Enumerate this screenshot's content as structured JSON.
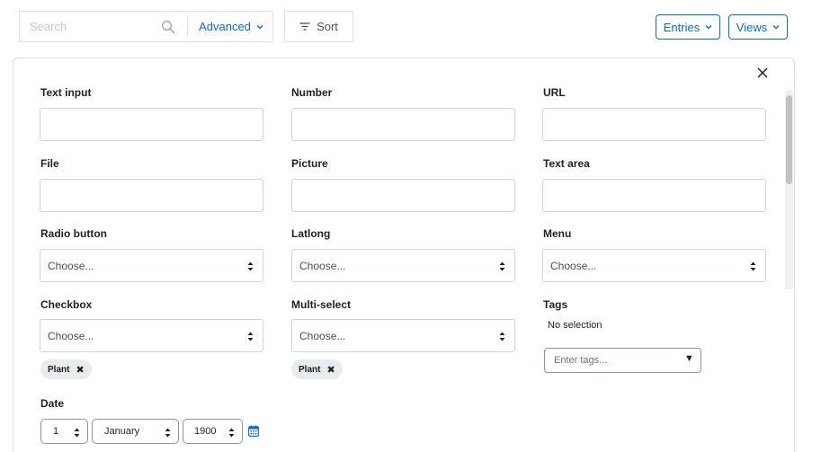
{
  "toolbar": {
    "search_placeholder": "Search",
    "advanced_label": "Advanced",
    "sort_label": "Sort",
    "entries_label": "Entries",
    "views_label": "Views"
  },
  "form": {
    "text_input_label": "Text input",
    "number_label": "Number",
    "url_label": "URL",
    "file_label": "File",
    "picture_label": "Picture",
    "textarea_label": "Text area",
    "radio_label": "Radio button",
    "radio_value": "Choose...",
    "latlong_label": "Latlong",
    "latlong_value": "Choose...",
    "menu_label": "Menu",
    "menu_value": "Choose...",
    "checkbox_label": "Checkbox",
    "checkbox_value": "Choose...",
    "checkbox_chip": "Plant",
    "multiselect_label": "Multi-select",
    "multiselect_value": "Choose...",
    "multiselect_chip": "Plant",
    "tags_label": "Tags",
    "tags_no_selection": "No selection",
    "tags_placeholder": "Enter tags...",
    "tags_arrow": "▼",
    "date_label": "Date",
    "date_day": "1",
    "date_month": "January",
    "date_year": "1900"
  },
  "colors": {
    "accent": "#0f6cbf",
    "border": "#ced4da",
    "chip_bg": "#e9ecef"
  }
}
